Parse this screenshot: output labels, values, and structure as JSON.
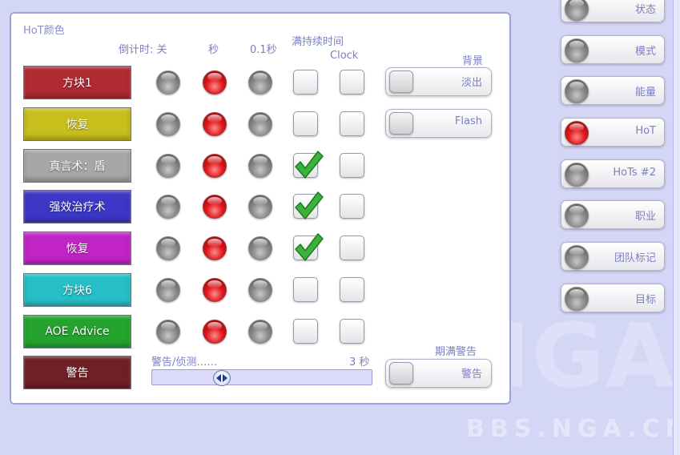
{
  "panel": {
    "title": "HoT颜色",
    "headers": {
      "countdown": "倒计时: 关",
      "seconds": "秒",
      "tenth_seconds": "0.1秒",
      "full_duration": "满持续时间",
      "clock": "Clock",
      "background": "背景"
    },
    "rows": [
      {
        "label": "方块1",
        "color": "#b02a33",
        "orbs": [
          "gray",
          "red",
          "gray"
        ],
        "full_duration_checked": false,
        "clock_checked": false
      },
      {
        "label": "恢复",
        "color": "#c8bf1c",
        "orbs": [
          "gray",
          "red",
          "gray"
        ],
        "full_duration_checked": false,
        "clock_checked": false
      },
      {
        "label": "真言术：盾",
        "color": "#a7a7a7",
        "orbs": [
          "gray",
          "red",
          "gray"
        ],
        "full_duration_checked": true,
        "clock_checked": false
      },
      {
        "label": "强效治疗术",
        "color": "#3c37c6",
        "orbs": [
          "gray",
          "red",
          "gray"
        ],
        "full_duration_checked": true,
        "clock_checked": false
      },
      {
        "label": "恢复",
        "color": "#c024c4",
        "orbs": [
          "gray",
          "red",
          "gray"
        ],
        "full_duration_checked": true,
        "clock_checked": false
      },
      {
        "label": "方块6",
        "color": "#27bfc7",
        "orbs": [
          "gray",
          "red",
          "gray"
        ],
        "full_duration_checked": false,
        "clock_checked": false
      },
      {
        "label": "AOE Advice",
        "color": "#25a32f",
        "orbs": [
          "gray",
          "red",
          "gray"
        ],
        "full_duration_checked": false,
        "clock_checked": false
      },
      {
        "label": "警告",
        "color": "#6f2025",
        "orbs": [],
        "full_duration_checked": false,
        "clock_checked": false
      }
    ],
    "toggles": {
      "fade": "淡出",
      "flash": "Flash"
    },
    "warning": {
      "slider_label": "警告/侦测……",
      "slider_value": "3 秒",
      "slider_fraction": 0.3,
      "expire_warning_label": "期满警告",
      "expire_toggle_label": "警告"
    }
  },
  "sidebar": {
    "items": [
      {
        "label": "状态",
        "active": false
      },
      {
        "label": "模式",
        "active": false
      },
      {
        "label": "能量",
        "active": false
      },
      {
        "label": "HoT",
        "active": true
      },
      {
        "label": "HoTs #2",
        "active": false
      },
      {
        "label": "职业",
        "active": false
      },
      {
        "label": "团队标记",
        "active": false
      },
      {
        "label": "目标",
        "active": false
      }
    ]
  },
  "watermark": {
    "logo": "NGA",
    "url": "BBS.NGA.CN"
  },
  "colors": {
    "accent_text": "#7c7fc0",
    "panel_border": "#9fa2d9",
    "background": "#d4d6f6"
  }
}
